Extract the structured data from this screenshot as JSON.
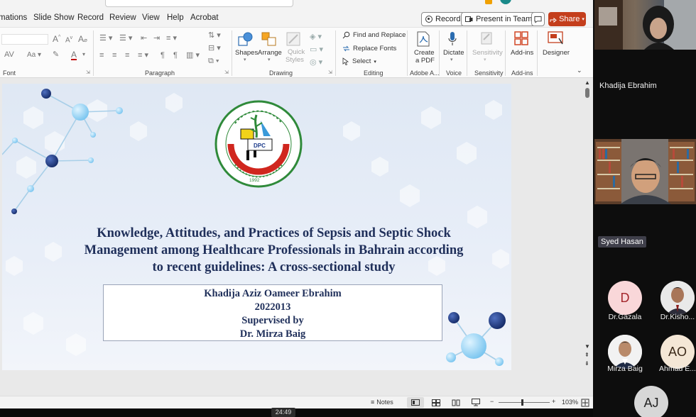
{
  "menu": {
    "items": [
      "mations",
      "Slide Show",
      "Record",
      "Review",
      "View",
      "Help",
      "Acrobat"
    ],
    "record_label": "Record",
    "present_label": "Present in Teams",
    "share_label": "Share"
  },
  "ribbon": {
    "groups": {
      "font": "Font",
      "paragraph": "Paragraph",
      "drawing": "Drawing",
      "editing": "Editing",
      "adobe": "Adobe A...",
      "voice": "Voice",
      "sensitivity": "Sensitivity",
      "addins": "Add-ins"
    },
    "drawing": {
      "shapes": "Shapes",
      "arrange": "Arrange",
      "quick_styles_1": "Quick",
      "quick_styles_2": "Styles"
    },
    "editing": {
      "find": "Find and Replace",
      "replace_fonts": "Replace Fonts",
      "select": "Select"
    },
    "adobe": {
      "create_1": "Create",
      "create_2": "a PDF"
    },
    "voice": {
      "dictate": "Dictate"
    },
    "sensitivity": {
      "label": "Sensitivity"
    },
    "addins": {
      "label": "Add-ins"
    },
    "designer": {
      "label": "Designer"
    }
  },
  "slide": {
    "title_lines": [
      "Knowledge, Attitudes, and Practices of Sepsis and Septic Shock",
      "Management among Healthcare Professionals in Bahrain according",
      "to recent guidelines: A cross-sectional study"
    ],
    "author": "Khadija Aziz Oameer Ebrahim",
    "id": "2022013",
    "supervised_label": "Supervised by",
    "supervisor": "Dr. Mirza Baig",
    "logo_text": "Dubai Pharmacy College",
    "logo_year": "1992"
  },
  "status": {
    "notes": "Notes",
    "zoom": "103%"
  },
  "timer": "24:49",
  "participants": {
    "video": [
      {
        "name": "Khadija Ebrahim"
      },
      {
        "name": "Syed Hasan"
      }
    ],
    "avatars": [
      {
        "initials": "D",
        "name": "Dr.Gazala",
        "bg": "#f9d7d9",
        "fg": "#a4262c"
      },
      {
        "initials": "",
        "name": "Dr.Kisho...",
        "bg": "#c9c9c9",
        "fg": "#333333"
      },
      {
        "initials": "",
        "name": "Mirza Baig",
        "bg": "#d9d9d9",
        "fg": "#333333"
      },
      {
        "initials": "AO",
        "name": "Ahmad E...",
        "bg": "#f4e7d6",
        "fg": "#3b2a1a"
      },
      {
        "initials": "AJ",
        "name": "",
        "bg": "#d7d7d7",
        "fg": "#222222"
      }
    ]
  },
  "colors": {
    "share": "#c43e1c",
    "title_navy": "#1f2f5a"
  }
}
